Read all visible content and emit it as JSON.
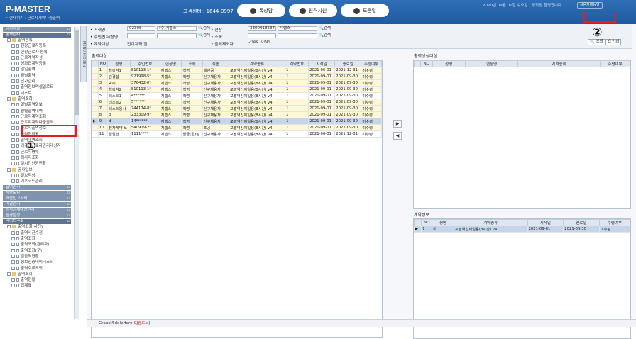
{
  "header": {
    "logo": "P-MASTER",
    "breadcrumb": "• 현재위치 : 근로자계약다중출력",
    "customer_center": "고객센터 : 1644-0997",
    "buttons": [
      {
        "label": "톡상담",
        "icon": "chat-icon"
      },
      {
        "label": "원격지원",
        "icon": "remote-icon"
      },
      {
        "label": "도움말",
        "icon": "help-icon"
      }
    ],
    "info": "2020년 09월 01일 수요일 | 영지앙 환영합니다.",
    "user_button": "사용자메뉴얼"
  },
  "sidebar": {
    "sections": [
      {
        "label": "공지사항",
        "items": []
      },
      {
        "label": "출역관리",
        "items": [
          {
            "label": "출역등록",
            "level": 0,
            "type": "folder"
          },
          {
            "label": "현장근로자등록",
            "level": 1
          },
          {
            "label": "현장근로자 등록",
            "level": 1
          },
          {
            "label": "근로계약작성",
            "level": 1
          },
          {
            "label": "성과급계약등록",
            "level": 1
          },
          {
            "label": "일일출역",
            "level": 1
          },
          {
            "label": "월별출역",
            "level": 1
          },
          {
            "label": "단가관리",
            "level": 1
          },
          {
            "label": "출역정보엑셀업로드",
            "level": 1
          },
          {
            "label": "테스트",
            "level": 1
          },
          {
            "label": "출역조회",
            "level": 0,
            "type": "folder"
          },
          {
            "label": "일별출역일보",
            "level": 1
          },
          {
            "label": "월별출역내역",
            "level": 1
          },
          {
            "label": "근로자계약조회",
            "level": 1
          },
          {
            "label": "근로자계약다중출력",
            "level": 1,
            "highlight": true
          },
          {
            "label": "근로자출역정보",
            "level": 1
          },
          {
            "label": "출역현황표",
            "level": 1
          },
          {
            "label": "출역내역조회",
            "level": 1
          },
          {
            "label": "외국인근로자관리대상자",
            "level": 1
          },
          {
            "label": "근로자명부",
            "level": 1
          },
          {
            "label": "퇴사자조회",
            "level": 1
          },
          {
            "label": "실시간인원현황",
            "level": 1
          },
          {
            "label": "공사일보",
            "level": 0,
            "type": "folder"
          },
          {
            "label": "일보작성",
            "level": 1
          },
          {
            "label": "기초코드관리",
            "level": 1
          }
        ]
      },
      {
        "label": "급여관리",
        "items": []
      },
      {
        "label": "세금보험",
        "items": []
      },
      {
        "label": "계산신고서식",
        "items": []
      },
      {
        "label": "마감관리",
        "items": []
      },
      {
        "label": "퇴직공제대상관리",
        "items": []
      },
      {
        "label": "환경설정",
        "items": []
      },
      {
        "label": "게이트구조",
        "items": [
          {
            "label": "출역조회(사진)",
            "level": 0,
            "type": "folder"
          },
          {
            "label": "출역사진수정",
            "level": 1
          },
          {
            "label": "출역조회",
            "level": 1
          },
          {
            "label": "출역조회(관리자)",
            "level": 1
          },
          {
            "label": "출역조회(구)",
            "level": 1
          },
          {
            "label": "일출역현황",
            "level": 1
          },
          {
            "label": "정보인증데이터조회",
            "level": 1
          },
          {
            "label": "출역오류조회",
            "level": 1
          },
          {
            "label": "출역조회",
            "level": 0,
            "type": "folder"
          },
          {
            "label": "출역현황",
            "level": 1
          },
          {
            "label": "집계표",
            "level": 1
          }
        ]
      }
    ],
    "vtab": "MENU HIDDEN"
  },
  "form": {
    "rows": [
      [
        {
          "label": "• 거래명",
          "code": "02308",
          "name": "(주)지렙스",
          "btn": "검색"
        },
        {
          "label": "• 현장",
          "code": "3300018537",
          "name": "지렙스",
          "btn": "검색"
        }
      ],
      [
        {
          "label": "• 주민번호/성명",
          "code": "",
          "name": "",
          "btn": "검색"
        },
        {
          "label": "• 소속",
          "code": "",
          "name": "",
          "btn": "검색"
        }
      ],
      [
        {
          "label": "• 계약대상",
          "value": "전이계약  일"
        },
        {
          "label": "• 출력제외자",
          "opt1": "Yes",
          "opt2": "No"
        }
      ]
    ],
    "search_btn": "조회",
    "print_btn": "인쇄"
  },
  "left_grid": {
    "title": "출력대상",
    "columns": [
      "",
      "NO",
      "성명",
      "주민번호",
      "현장명",
      "소속",
      "직종",
      "계약종류",
      "계약번호",
      "시작일",
      "종료일",
      "수령여부"
    ],
    "rows": [
      [
        "",
        "1",
        "최강석1",
        "810113-1*",
        "지렙스",
        "직영",
        "배관공",
        "포괄역산제일용(8시간) v4.",
        "1",
        "2021-06-01",
        "2021-12-31",
        "미수령"
      ],
      [
        "",
        "2",
        "김경섭",
        "921998-5*",
        "지렙스",
        "직영",
        "신규채용자",
        "포괄역산제일용(8시간) v4.",
        "1",
        "2021-09-01",
        "2021-09-30",
        "미수령"
      ],
      [
        "",
        "3",
        "박씨",
        "376432-0*",
        "지렙스",
        "직영",
        "신규채용자",
        "포괄역산제일용(8시간) v4.",
        "1",
        "2021-09-01",
        "2021-09-30",
        "미수령"
      ],
      [
        "",
        "4",
        "최강석2",
        "810113-1*",
        "지렙스",
        "직영",
        "신규채용자",
        "포괄역산제일용(8시간) v4.",
        "1",
        "2021-09-01",
        "2021-09-30",
        "미수령"
      ],
      [
        "",
        "5",
        "테스트1",
        "4******",
        "지렙스",
        "직영",
        "신규채용자",
        "포괄역산제일용(8시간) v4.",
        "1",
        "2021-09-01",
        "2021-09-30",
        "미수령"
      ],
      [
        "",
        "6",
        "테스트2",
        "5******",
        "지렙스",
        "직영",
        "신규채용자",
        "포괄역산제일용(8시간) v4.",
        "1",
        "2021-09-01",
        "2021-09-30",
        "미수령"
      ],
      [
        "",
        "7",
        "테스트용사",
        "744174-8*",
        "지렙스",
        "직영",
        "신규채용자",
        "포괄역산제일용(8시간) v4.",
        "1",
        "2021-09-01",
        "2021-09-30",
        "미수령"
      ],
      [
        "",
        "8",
        "b",
        "233309-9*",
        "지렙스",
        "직영",
        "신규채용자",
        "포괄역산제일용(8시간) v4.",
        "1",
        "2021-09-01",
        "2021-09-30",
        "미수령"
      ],
      [
        "▶",
        "9",
        "d",
        "14******",
        "지렙스",
        "직영",
        "신규채용자",
        "포괄역산제일용(8시간) v4.",
        "1",
        "2021-09-01",
        "2021-09-30",
        "미수령"
      ],
      [
        "",
        "10",
        "전자계약 노",
        "540919-2*",
        "지렙스",
        "직영",
        "조공",
        "포괄역산제일용(8시간) v4.",
        "1",
        "2021-09-01",
        "2021-09-30",
        "미수령"
      ],
      [
        "",
        "11",
        "임임한",
        "1111****",
        "지렙스",
        "임금(편)질",
        "신규채용자",
        "포괄역산제일용(8시간) v4.",
        "1",
        "2021-06-01",
        "2021-12-31",
        "미수령"
      ]
    ]
  },
  "right_grid": {
    "title": "출력생성대상",
    "columns": [
      "",
      "NO",
      "성명",
      "현장명",
      "계약종류",
      "수령여부"
    ]
  },
  "contract_grid": {
    "title": "계약정보",
    "columns": [
      "",
      "NO",
      "성명",
      "계약종류",
      "시작일",
      "종료일",
      "수령여부"
    ],
    "rows": [
      [
        "▶",
        "1",
        "d",
        "포괄역산제일용(8시간) v4.",
        "2021-09-01",
        "2021-09-30",
        "미수령"
      ]
    ]
  },
  "arrows": {
    "right": "▶",
    "left": "◀"
  },
  "status": {
    "prefix": "GrabsMiddleHere(",
    "red": "CJ중로드",
    "suffix": ")"
  },
  "annotations": {
    "one": "①",
    "two": "②"
  }
}
